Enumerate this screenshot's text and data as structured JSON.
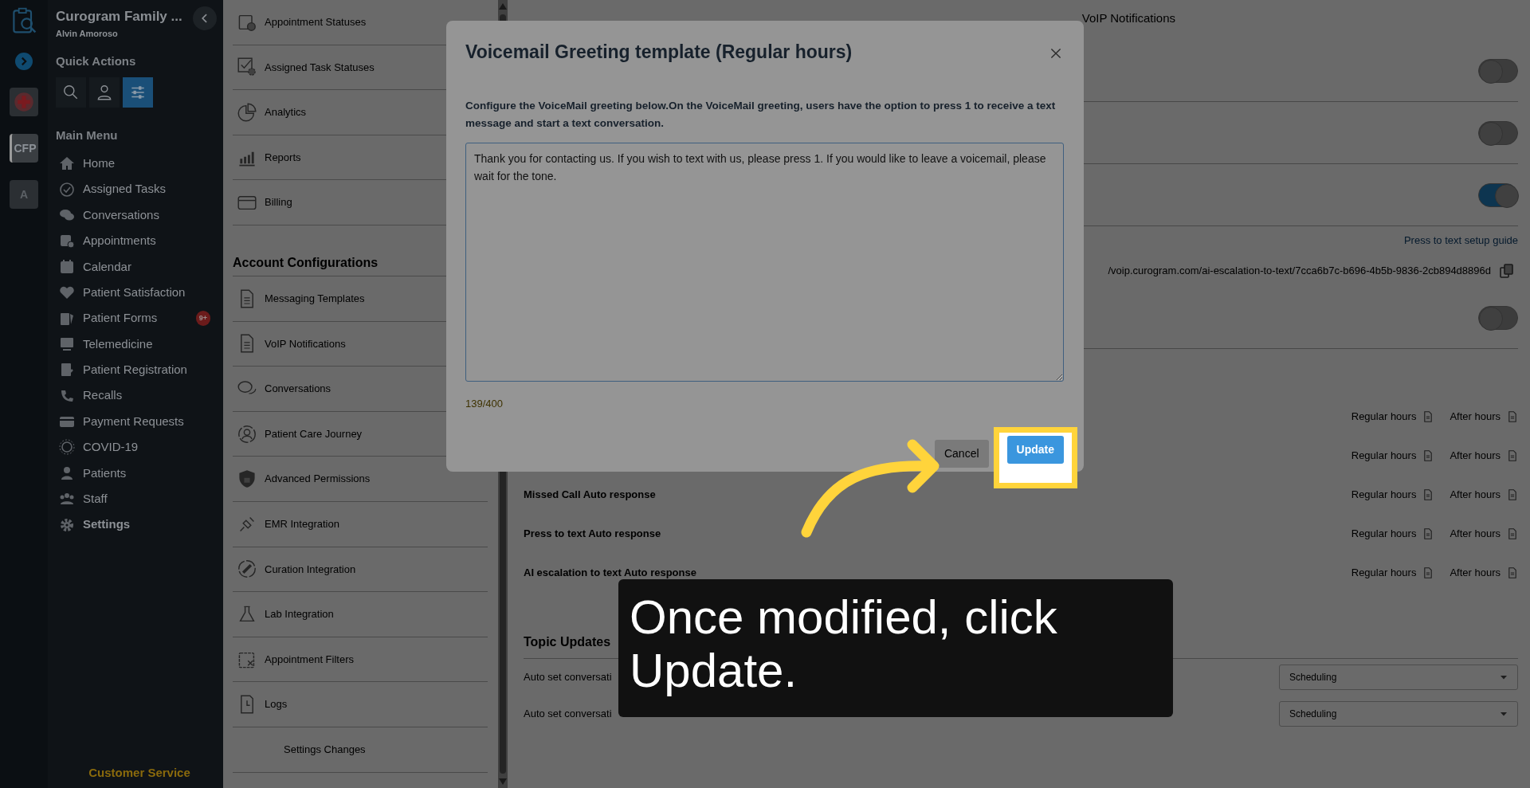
{
  "rail": {
    "items": [
      {
        "kind": "expand"
      },
      {
        "kind": "app"
      },
      {
        "kind": "tile",
        "label": "CFP",
        "selected": true
      },
      {
        "kind": "tile",
        "label": "A",
        "selected": false
      }
    ]
  },
  "sidebar": {
    "org": "Curogram Family ...",
    "user": "Alvin Amoroso",
    "quick_title": "Quick Actions",
    "quick_actions": [
      {
        "selected": false
      },
      {
        "selected": false
      },
      {
        "selected": true
      }
    ],
    "menu_title": "Main Menu",
    "items": [
      {
        "label": "Home",
        "selected": false
      },
      {
        "label": "Assigned Tasks",
        "selected": false
      },
      {
        "label": "Conversations",
        "selected": false
      },
      {
        "label": "Appointments",
        "selected": false
      },
      {
        "label": "Calendar",
        "selected": false
      },
      {
        "label": "Patient Satisfaction",
        "selected": false
      },
      {
        "label": "Patient Forms",
        "selected": false,
        "badge": "9+"
      },
      {
        "label": "Telemedicine",
        "selected": false
      },
      {
        "label": "Patient Registration",
        "selected": false
      },
      {
        "label": "Recalls",
        "selected": false
      },
      {
        "label": "Payment Requests",
        "selected": false
      },
      {
        "label": "COVID-19",
        "selected": false
      },
      {
        "label": "Patients",
        "selected": false
      },
      {
        "label": "Staff",
        "selected": false
      },
      {
        "label": "Settings",
        "selected": true
      }
    ],
    "footer": "Customer Service"
  },
  "settings_menu": {
    "items": [
      {
        "label": "Appointment Statuses"
      },
      {
        "label": "Assigned Task Statuses"
      },
      {
        "label": "Analytics"
      },
      {
        "label": "Reports"
      },
      {
        "label": "Billing"
      }
    ],
    "section": {
      "title": "Account Configurations",
      "items": [
        {
          "label": "Messaging Templates",
          "kind": "icon"
        },
        {
          "label": "VoIP Notifications",
          "kind": "icon"
        },
        {
          "label": "Conversations",
          "kind": "icon"
        },
        {
          "label": "Patient Care Journey",
          "kind": "icon"
        },
        {
          "label": "Advanced Permissions",
          "kind": "icon"
        },
        {
          "label": "EMR Integration",
          "kind": "icon"
        },
        {
          "label": "Curation Integration",
          "kind": "icon"
        },
        {
          "label": "Lab Integration",
          "kind": "icon"
        },
        {
          "label": "Appointment Filters",
          "kind": "icon"
        },
        {
          "label": "Logs",
          "kind": "icon"
        },
        {
          "label": "Settings Changes",
          "kind": "sub"
        }
      ]
    }
  },
  "voip": {
    "heading": "VoIP Notifications",
    "rows": [
      {
        "kind": "toggle",
        "on": false
      },
      {
        "kind": "toggle",
        "on": false
      },
      {
        "kind": "toggle",
        "on": true
      },
      {
        "kind": "link",
        "text": "Press to text setup guide"
      },
      {
        "kind": "url",
        "text": "/voip.curogram.com/ai-escalation-to-text/7cca6b7c-b696-4b5b-9836-2cb894d8896d"
      },
      {
        "kind": "toggle",
        "on": false
      }
    ],
    "templates": [
      {
        "regular": "Regular hours",
        "after": "After hours"
      },
      {
        "regular": "Regular hours",
        "after": "After hours"
      },
      {
        "label": "Missed Call Auto response",
        "regular": "Regular hours",
        "after": "After hours"
      },
      {
        "label": "Press to text Auto response",
        "regular": "Regular hours",
        "after": "After hours"
      },
      {
        "label": "AI escalation to text Auto response",
        "regular": "Regular hours",
        "after": "After hours"
      }
    ]
  },
  "topic_updates": {
    "title": "Topic Updates",
    "rows": [
      {
        "label": "Auto set conversati",
        "value": "Scheduling"
      },
      {
        "label": "Auto set conversati",
        "value": "Scheduling"
      }
    ]
  },
  "modal": {
    "title": "Voicemail Greeting template (Regular hours)",
    "description": "Configure the VoiceMail greeting below.On the VoiceMail greeting, users have the option to press 1 to receive a text message and start a text conversation.",
    "value": "Thank you for contacting us. If you wish to text with us, please press 1. If you would like to leave a voicemail, please wait for the tone.",
    "counter": "139/400",
    "buttons": [
      {
        "label": "Cancel",
        "highlighted": false
      },
      {
        "label": "Update",
        "highlighted": true
      }
    ]
  },
  "caption": "Once modified, click Update."
}
